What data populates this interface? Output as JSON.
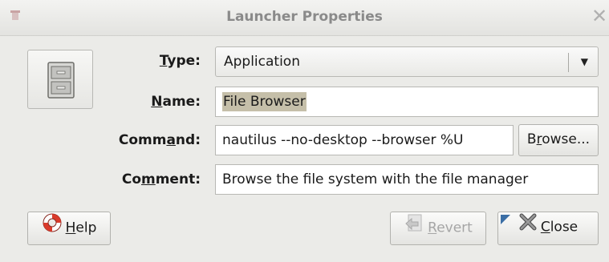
{
  "window": {
    "title": "Launcher Properties",
    "icon": "launcher-window-icon",
    "close_icon": "close-x-icon"
  },
  "icon_button": {
    "icon": "file-cabinet-icon"
  },
  "form": {
    "type": {
      "label_pre": "",
      "label_ul": "T",
      "label_post": "ype:",
      "value": "Application"
    },
    "name": {
      "label_pre": "",
      "label_ul": "N",
      "label_post": "ame:",
      "value": "File Browser"
    },
    "command": {
      "label_pre": "Comm",
      "label_ul": "a",
      "label_post": "nd:",
      "value": "nautilus --no-desktop --browser %U"
    },
    "comment": {
      "label_pre": "Co",
      "label_ul": "m",
      "label_post": "ment:",
      "value": "Browse the file system with the file manager"
    }
  },
  "buttons": {
    "browse": {
      "pre": "B",
      "ul": "r",
      "post": "owse..."
    },
    "help": {
      "pre": "",
      "ul": "H",
      "post": "elp",
      "icon": "lifebuoy-icon"
    },
    "revert": {
      "pre": "",
      "ul": "R",
      "post": "evert",
      "icon": "revert-icon",
      "enabled": false
    },
    "close": {
      "pre": "",
      "ul": "C",
      "post": "lose",
      "icon": "close-icon"
    }
  },
  "colors": {
    "background": "#ebebe8",
    "selection": "#c5bfa9",
    "lifebuoy": "#d93a2b"
  }
}
